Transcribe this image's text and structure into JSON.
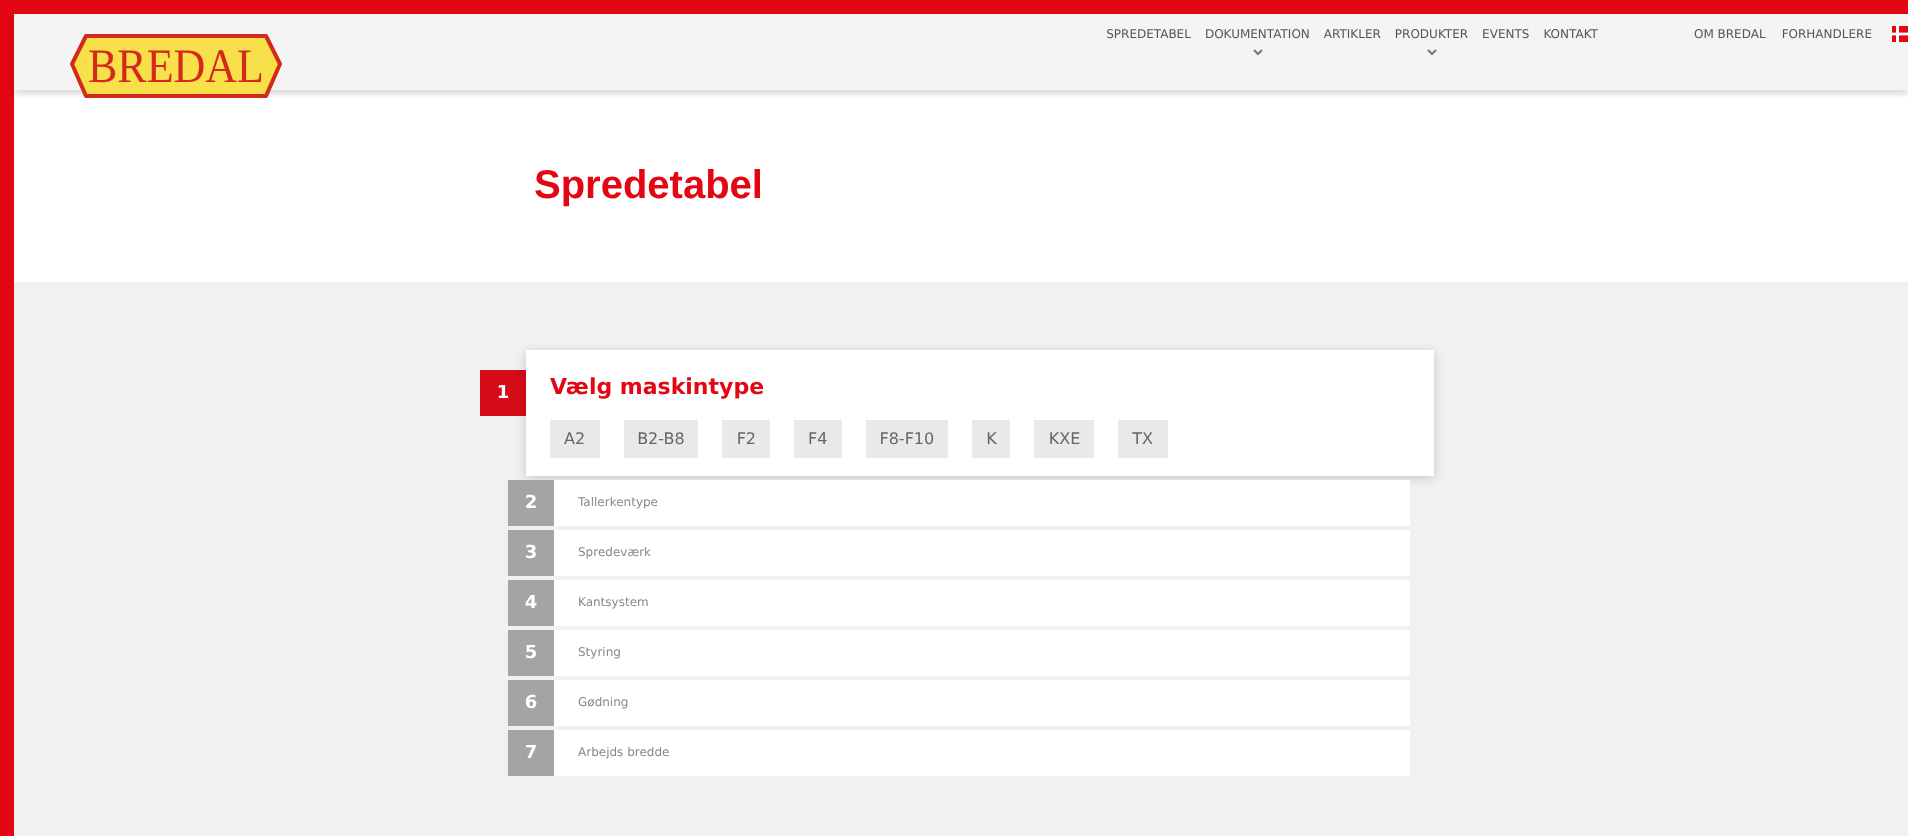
{
  "logo": {
    "text": "BREDAL"
  },
  "nav": [
    {
      "label": "SPREDETABEL",
      "has_submenu": false
    },
    {
      "label": "DOKUMENTATION",
      "has_submenu": true
    },
    {
      "label": "ARTIKLER",
      "has_submenu": false
    },
    {
      "label": "PRODUKTER",
      "has_submenu": true
    },
    {
      "label": "EVENTS",
      "has_submenu": false
    },
    {
      "label": "KONTAKT",
      "has_submenu": false
    }
  ],
  "secondary_nav": [
    "OM BREDAL",
    "FORHANDLERE"
  ],
  "page_title": "Spredetabel",
  "steps": [
    {
      "number": "1",
      "title": "Vælg maskintype",
      "active": true,
      "options": [
        "A2",
        "B2-B8",
        "F2",
        "F4",
        "F8-F10",
        "K",
        "KXE",
        "TX"
      ]
    },
    {
      "number": "2",
      "title": "Tallerkentype",
      "active": false
    },
    {
      "number": "3",
      "title": "Spredeværk",
      "active": false
    },
    {
      "number": "4",
      "title": "Kantsystem",
      "active": false
    },
    {
      "number": "5",
      "title": "Styring",
      "active": false
    },
    {
      "number": "6",
      "title": "Gødning",
      "active": false
    },
    {
      "number": "7",
      "title": "Arbejds bredde",
      "active": false
    }
  ]
}
